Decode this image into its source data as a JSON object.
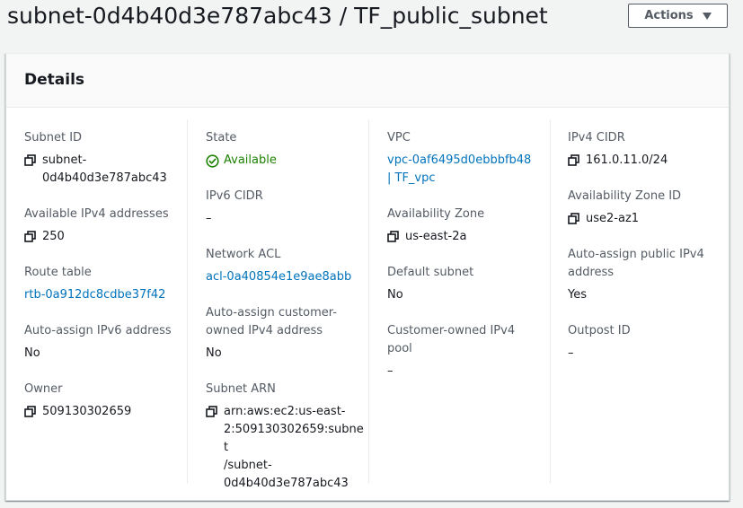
{
  "header": {
    "title": "subnet-0d4b40d3e787abc43 / TF_public_subnet",
    "actions_label": "Actions"
  },
  "panel": {
    "title": "Details"
  },
  "colors": {
    "link": "#0073bb",
    "success": "#1d8102",
    "label": "#545b64",
    "text": "#16191f"
  },
  "fields": {
    "subnet_id": {
      "label": "Subnet ID",
      "value": "subnet-\n0d4b40d3e787abc43",
      "icon": "copy-icon"
    },
    "available_ipv4": {
      "label": "Available IPv4 addresses",
      "value": "250",
      "icon": "copy-icon"
    },
    "route_table": {
      "label": "Route table",
      "value": "rtb-0a912dc8cdbe37f42"
    },
    "auto_assign_ipv6": {
      "label": "Auto-assign IPv6 address",
      "value": "No"
    },
    "owner": {
      "label": "Owner",
      "value": "509130302659",
      "icon": "copy-icon"
    },
    "state": {
      "label": "State",
      "value": "Available",
      "icon": "check-circle-icon"
    },
    "ipv6_cidr": {
      "label": "IPv6 CIDR",
      "value": "–"
    },
    "network_acl": {
      "label": "Network ACL",
      "value": "acl-0a40854e1e9ae8abb"
    },
    "auto_assign_customer_owned": {
      "label": "Auto-assign customer-\nowned IPv4 address",
      "value": "No"
    },
    "subnet_arn": {
      "label": "Subnet ARN",
      "value": "arn:aws:ec2:us-east-\n2:509130302659:subnet\n/subnet-\n0d4b40d3e787abc43",
      "icon": "copy-icon"
    },
    "vpc": {
      "label": "VPC",
      "value": "vpc-0af6495d0ebbbfb48\n| TF_vpc"
    },
    "availability_zone": {
      "label": "Availability Zone",
      "value": "us-east-2a",
      "icon": "copy-icon"
    },
    "default_subnet": {
      "label": "Default subnet",
      "value": "No"
    },
    "customer_owned_ipv4_pool": {
      "label": "Customer-owned IPv4\npool",
      "value": "–"
    },
    "ipv4_cidr": {
      "label": "IPv4 CIDR",
      "value": "161.0.11.0/24",
      "icon": "copy-icon"
    },
    "availability_zone_id": {
      "label": "Availability Zone ID",
      "value": "use2-az1",
      "icon": "copy-icon"
    },
    "auto_assign_public_ipv4": {
      "label": "Auto-assign public IPv4\naddress",
      "value": "Yes"
    },
    "outpost_id": {
      "label": "Outpost ID",
      "value": "–"
    }
  }
}
